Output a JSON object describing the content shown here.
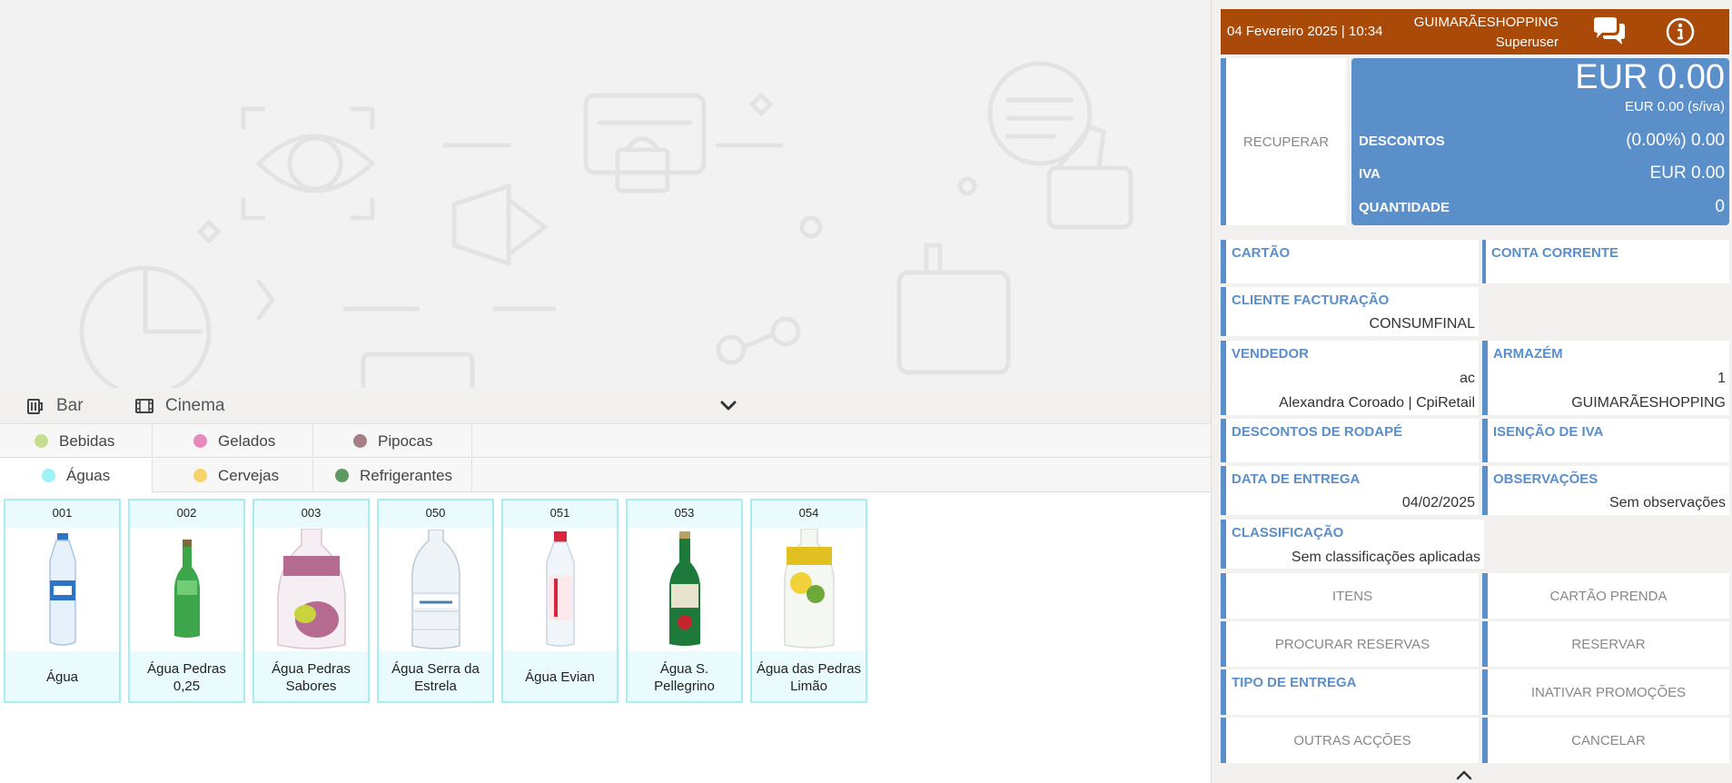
{
  "families": [
    {
      "label": "Bar",
      "icon": "beer-mug-icon"
    },
    {
      "label": "Cinema",
      "icon": "film-icon"
    }
  ],
  "categories_row1": [
    {
      "label": "Bebidas",
      "color": "#c5dd8e"
    },
    {
      "label": "Gelados",
      "color": "#e78bbd"
    },
    {
      "label": "Pipocas",
      "color": "#a67f86"
    }
  ],
  "categories_row2": [
    {
      "label": "Águas",
      "color": "#9ff1f4"
    },
    {
      "label": "Cervejas",
      "color": "#f5d56b"
    },
    {
      "label": "Refrigerantes",
      "color": "#5d9a63"
    }
  ],
  "products": [
    {
      "code": "001",
      "name": "Água",
      "icon": "water-bottle-icon",
      "color": "#2b74c7"
    },
    {
      "code": "002",
      "name": "Água Pedras 0,25",
      "icon": "green-glass-bottle-icon",
      "color": "#3ea64a"
    },
    {
      "code": "003",
      "name": "Água Pedras Sabores",
      "icon": "flavored-bottle-icon",
      "color": "#b46b8f"
    },
    {
      "code": "050",
      "name": "Água Serra da Estrela",
      "icon": "water-bottle-icon",
      "color": "#8fb0c8"
    },
    {
      "code": "051",
      "name": "Água Evian",
      "icon": "water-bottle-icon",
      "color": "#d7263d"
    },
    {
      "code": "053",
      "name": "Água S. Pellegrino",
      "icon": "green-glass-bottle-icon",
      "color": "#1d7a3b"
    },
    {
      "code": "054",
      "name": "Água das Pedras Limão",
      "icon": "flavored-bottle-icon",
      "color": "#e3c021"
    }
  ],
  "header": {
    "datetime": "04 Fevereiro 2025 | 10:34",
    "store": "GUIMARÃESHOPPING",
    "user": "Superuser",
    "color": "#a94a09"
  },
  "recuperar_label": "RECUPERAR",
  "totals": {
    "total": "EUR 0.00",
    "total_siva": "EUR 0.00 (s/iva)",
    "descontos_label": "DESCONTOS",
    "descontos_value": "(0.00%) 0.00",
    "iva_label": "IVA",
    "iva_value": "EUR 0.00",
    "quantidade_label": "QUANTIDADE",
    "quantidade_value": "0",
    "color": "#5b8fc9"
  },
  "fields": {
    "cartao": "CARTÃO",
    "conta_corrente": "CONTA CORRENTE",
    "cliente_label": "CLIENTE FACTURAÇÃO",
    "cliente_value": "CONSUMFINAL",
    "vendedor_label": "VENDEDOR",
    "vendedor_code": "ac",
    "vendedor_name": "Alexandra Coroado | CpiRetail",
    "armazem_label": "ARMAZÉM",
    "armazem_code": "1",
    "armazem_name": "GUIMARÃESHOPPING",
    "descontos_rodape": "DESCONTOS DE RODAPÉ",
    "isencao_iva": "ISENÇÃO DE IVA",
    "data_entrega_label": "DATA DE ENTREGA",
    "data_entrega_value": "04/02/2025",
    "observacoes_label": "OBSERVAÇÕES",
    "observacoes_value": "Sem observações",
    "classificacao_label": "CLASSIFICAÇÃO",
    "classificacao_value": "Sem classificações aplicadas",
    "tipo_entrega": "TIPO DE ENTREGA"
  },
  "buttons": {
    "itens": "ITENS",
    "cartao_prenda": "CARTÃO PRENDA",
    "procurar_reservas": "PROCURAR RESERVAS",
    "reservar": "RESERVAR",
    "inativar_promocoes": "INATIVAR PROMOÇÕES",
    "outras_accoes": "OUTRAS ACÇÕES",
    "cancelar": "CANCELAR"
  }
}
